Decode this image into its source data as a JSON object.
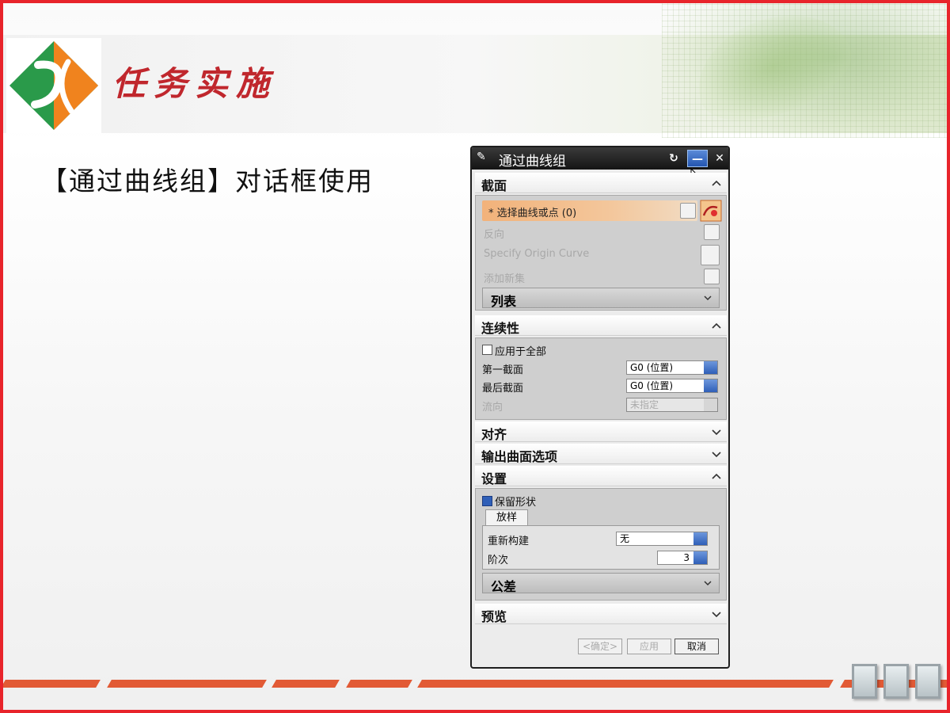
{
  "slide": {
    "title": "任务实施",
    "subtitle": "【通过曲线组】对话框使用"
  },
  "dialog": {
    "title": "通过曲线组",
    "sections": {
      "section": {
        "label": "截面",
        "select_label": "* 选择曲线或点 (0)",
        "reverse_label": "反向",
        "specify_origin_label": "Specify Origin Curve",
        "add_set_label": "添加新集",
        "list_label": "列表"
      },
      "continuity": {
        "label": "连续性",
        "apply_all_label": "应用于全部",
        "first_label": "第一截面",
        "first_value": "G0 (位置)",
        "last_label": "最后截面",
        "last_value": "G0 (位置)",
        "flow_dir_label": "流向",
        "flow_dir_value": "未指定"
      },
      "alignment": {
        "label": "对齐"
      },
      "output": {
        "label": "输出曲面选项"
      },
      "settings": {
        "label": "设置",
        "keep_shape_label": "保留形状",
        "tab_label": "放样",
        "rebuild_label": "重新构建",
        "rebuild_value": "无",
        "degree_label": "阶次",
        "degree_value": "3",
        "tolerance_label": "公差"
      },
      "preview": {
        "label": "预览"
      }
    },
    "buttons": {
      "ok": "<确定>",
      "apply": "应用",
      "cancel": "取消"
    }
  },
  "colors": {
    "border": "#e8242b",
    "title": "#c0272d",
    "stripe": "#e25a35",
    "logo_green": "#2a9a4a",
    "logo_orange": "#f0831e"
  }
}
